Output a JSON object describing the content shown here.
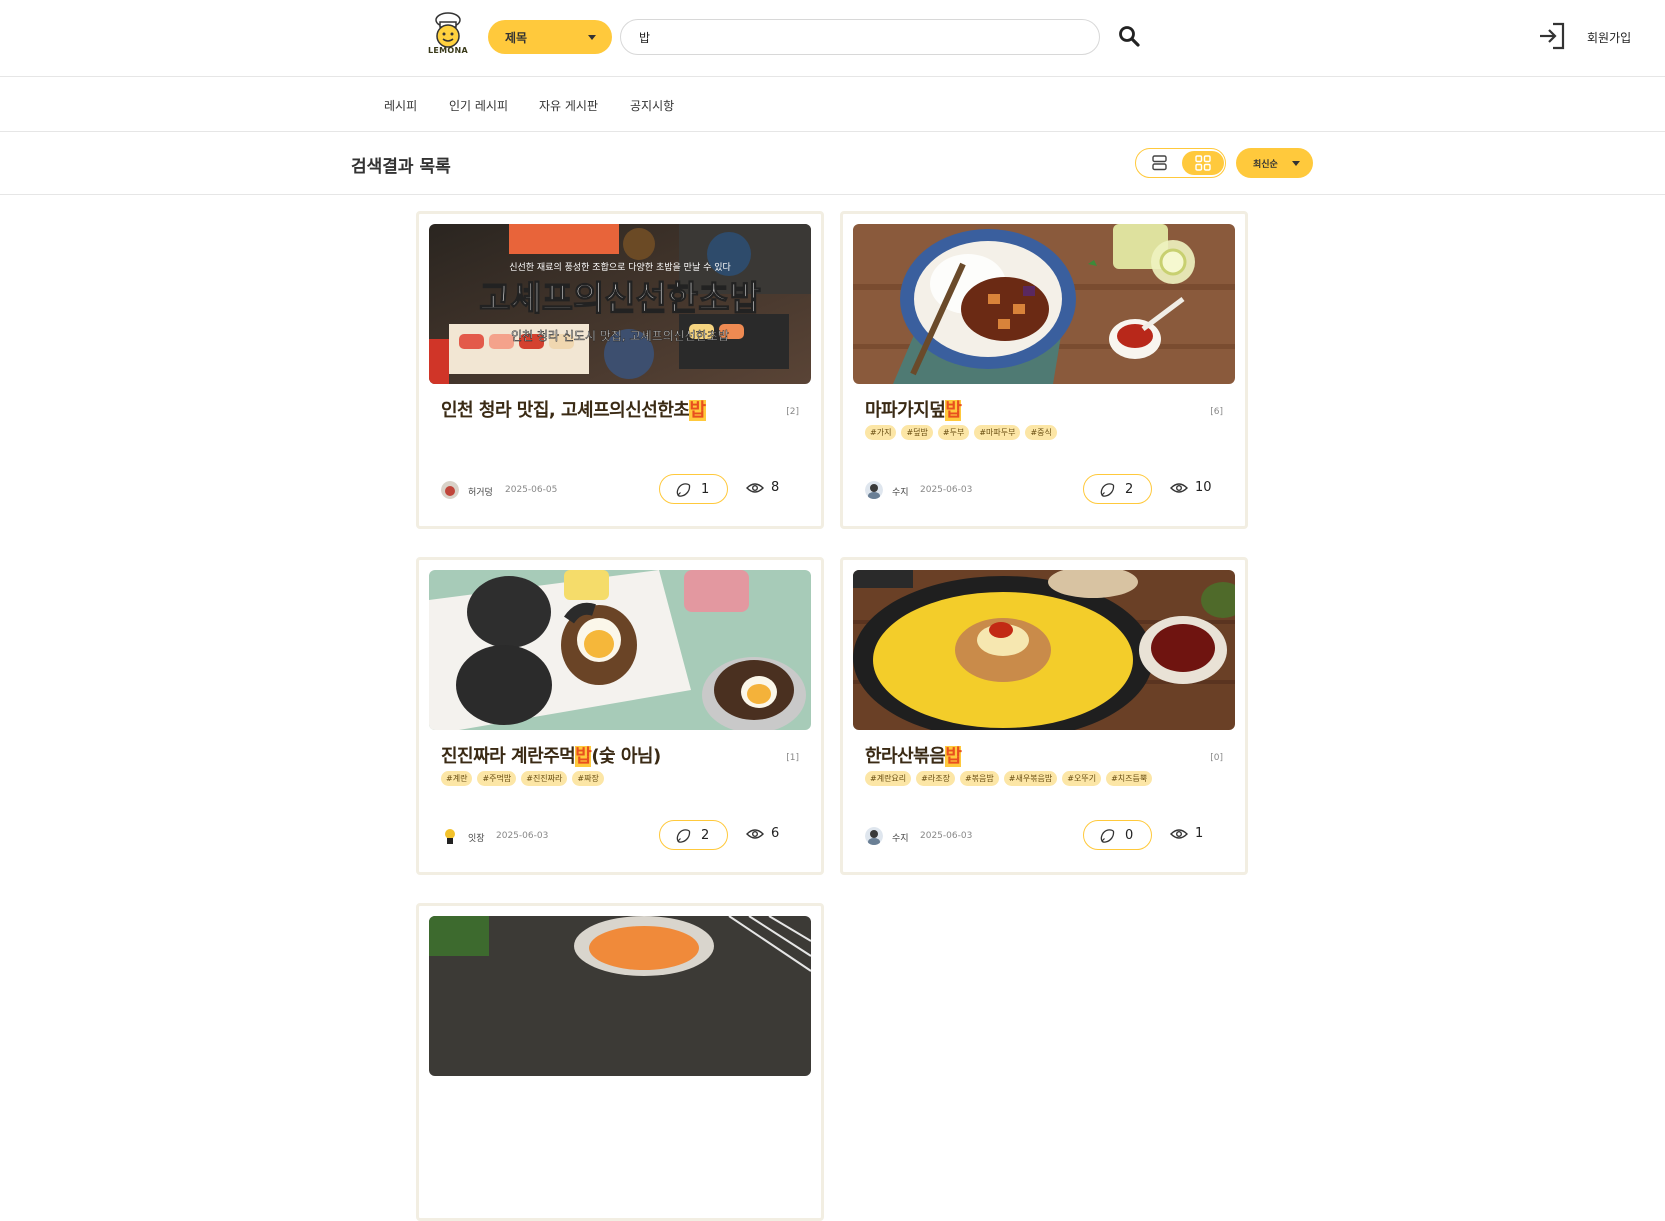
{
  "header": {
    "logo_text": "LEMONA",
    "category": "제목",
    "search_value": "밥",
    "signup": "회원가입"
  },
  "nav": {
    "items": [
      {
        "label": "레시피"
      },
      {
        "label": "인기 레시피"
      },
      {
        "label": "자유 게시판"
      },
      {
        "label": "공지시항"
      }
    ]
  },
  "results": {
    "title": "검색결과 목록",
    "sort": "최신순"
  },
  "colors": {
    "accent": "#ffc93c",
    "highlight_text": "#e8501e",
    "tag_bg": "#fce6a6"
  },
  "cards": [
    {
      "title_pre": "인천 청라 맛집, 고셰프의신선한초",
      "title_hl": "밥",
      "title_post": "",
      "count": "[2]",
      "tags": [],
      "author": "허거덩",
      "date": "2025-06-05",
      "likes": "1",
      "views": "8",
      "image_text": {
        "top": "신선한 재료의 풍성한 조합으로 다양한 초밥을 만날 수 있다",
        "big": "고셰프의신선한초밥",
        "sub": "인천 청라 신도시 맛집, 고셰프의신선한초밥"
      }
    },
    {
      "title_pre": "마파가지덮",
      "title_hl": "밥",
      "title_post": "",
      "count": "[6]",
      "tags": [
        "#가지",
        "#덮밥",
        "#두부",
        "#마파두부",
        "#중식"
      ],
      "author": "수지",
      "date": "2025-06-03",
      "likes": "2",
      "views": "10"
    },
    {
      "title_pre": "진진짜라 계란주먹",
      "title_hl": "밥",
      "title_post": "(숯 아님)",
      "count": "[1]",
      "tags": [
        "#계란",
        "#주먹밥",
        "#진진짜라",
        "#짜장"
      ],
      "author": "잇장",
      "date": "2025-06-03",
      "likes": "2",
      "views": "6"
    },
    {
      "title_pre": "한라산볶음",
      "title_hl": "밥",
      "title_post": "",
      "count": "[0]",
      "tags": [
        "#계란요리",
        "#라조장",
        "#볶음밥",
        "#새우볶음밥",
        "#오뚜기",
        "#치즈듬뿍"
      ],
      "author": "수지",
      "date": "2025-06-03",
      "likes": "0",
      "views": "1"
    }
  ]
}
